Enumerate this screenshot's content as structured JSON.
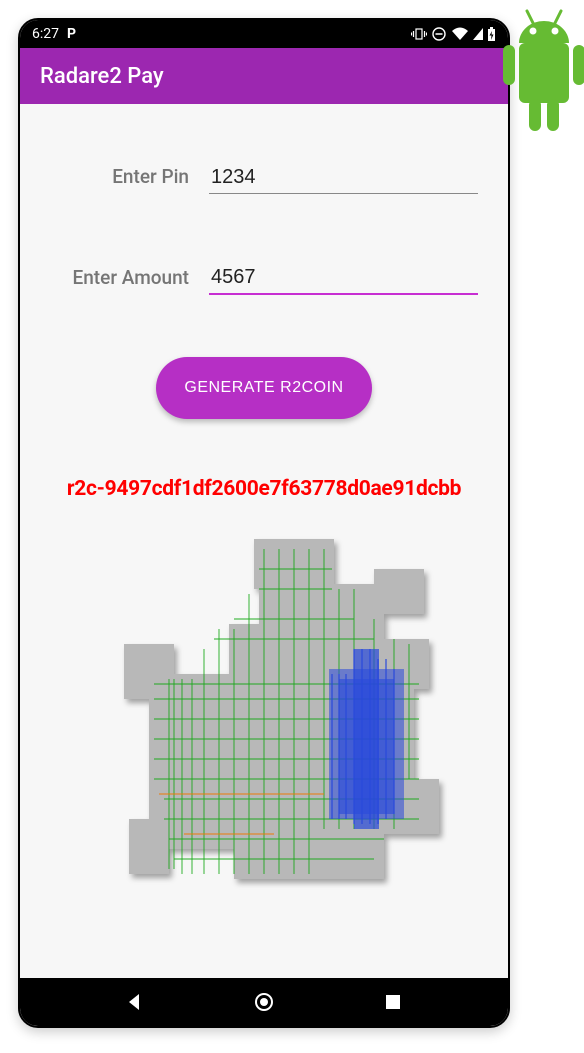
{
  "status": {
    "time": "6:27",
    "icons": {
      "app": "P"
    }
  },
  "appbar": {
    "title": "Radare2 Pay"
  },
  "form": {
    "pin_label": "Enter Pin",
    "pin_value": "1234",
    "amount_label": "Enter Amount",
    "amount_value": "4567"
  },
  "button": {
    "generate_label": "GENERATE R2COIN"
  },
  "result": {
    "code": "r2c-9497cdf1df2600e7f63778d0ae91dcbb"
  },
  "colors": {
    "primary": "#9c27b0",
    "accent": "#c72ed2",
    "result": "#ff0000"
  }
}
